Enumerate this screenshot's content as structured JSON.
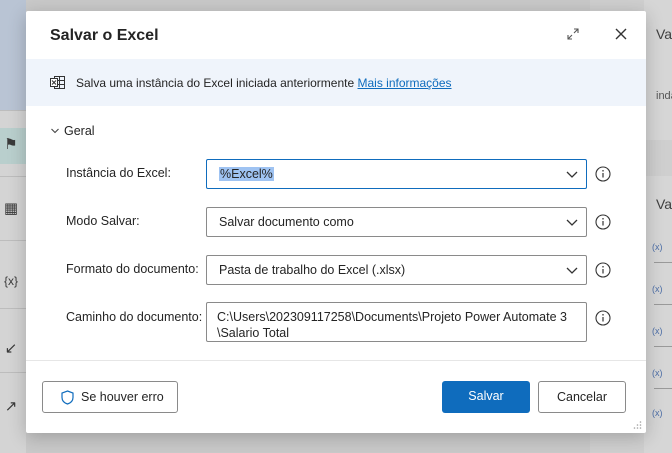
{
  "dialog": {
    "title": "Salvar o Excel",
    "info_text": "Salva uma instância do Excel iniciada anteriormente",
    "info_link": "Mais informações",
    "section_label": "Geral"
  },
  "fields": {
    "instance": {
      "label": "Instância do Excel:",
      "value": "%Excel%"
    },
    "save_mode": {
      "label": "Modo Salvar:",
      "value": "Salvar documento como"
    },
    "format": {
      "label": "Formato do documento:",
      "value": "Pasta de trabalho do Excel (.xlsx)"
    },
    "path": {
      "label": "Caminho do documento:",
      "value_line1": "C:\\Users\\202309117258\\Documents\\Projeto Power Automate 3",
      "value_line2": "\\Salario Total"
    }
  },
  "footer": {
    "error_button": "Se houver erro",
    "save_button": "Salvar",
    "cancel_button": "Cancelar"
  },
  "background": {
    "right_title_top": "Va",
    "right_subtext": "inda",
    "right_title_mid": "Va",
    "var_badge": "(x)",
    "left_var_glyph": "{x}"
  },
  "colors": {
    "accent": "#0f6cbd",
    "info_bar": "#eff4fb"
  }
}
